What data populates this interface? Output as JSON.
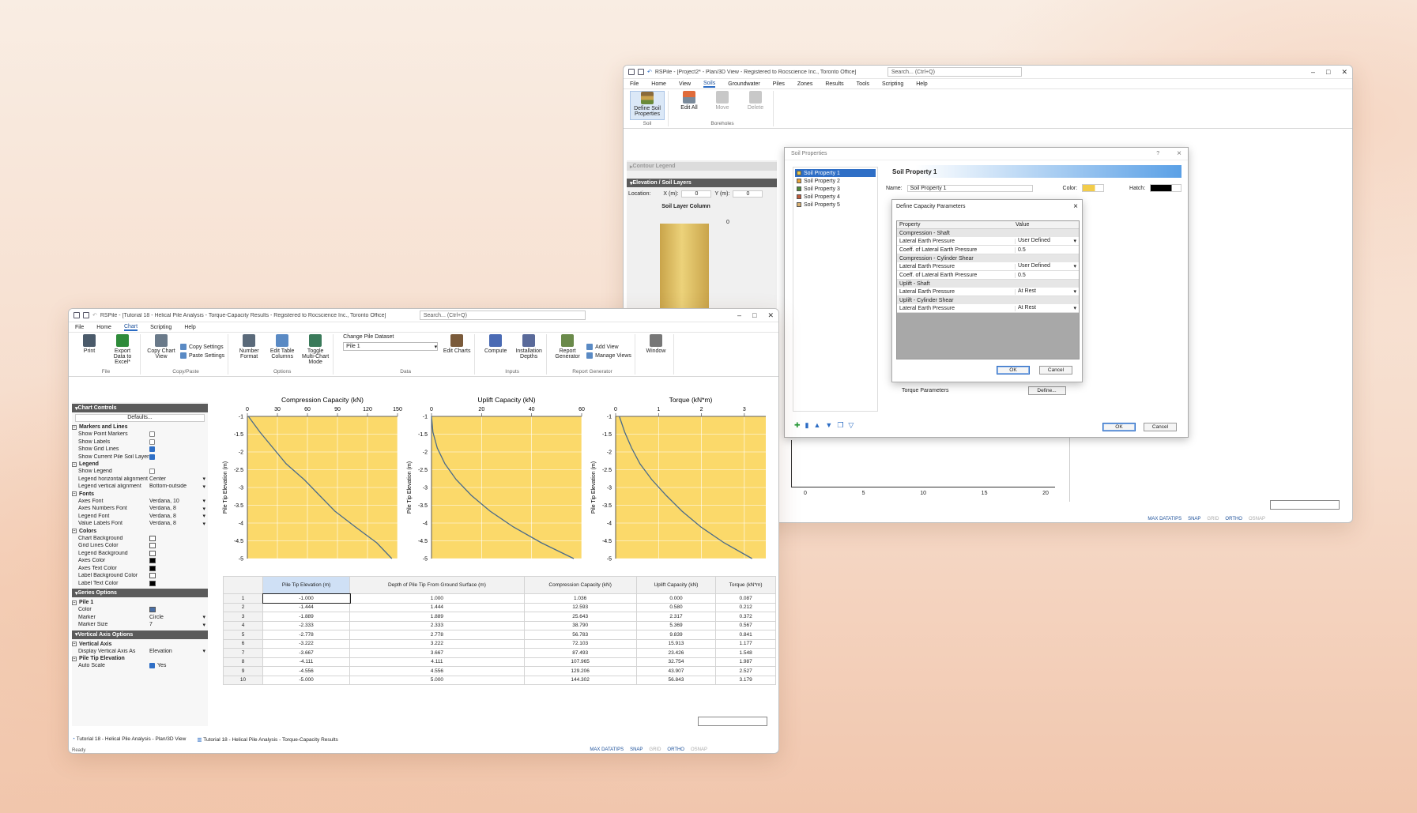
{
  "back": {
    "title": "RSPile - [Project2* - Plan/3D View - Registered to Rocscience Inc., Toronto Office]",
    "search": "Search... (Ctrl+Q)",
    "menu": [
      "File",
      "Home",
      "View",
      "Soils",
      "Groundwater",
      "Piles",
      "Zones",
      "Results",
      "Tools",
      "Scripting",
      "Help"
    ],
    "active_menu": "Soils",
    "ribbon": [
      {
        "label": "Define Soil Properties",
        "group": "Soil"
      },
      {
        "label": "Edit All",
        "group": "Boreholes"
      },
      {
        "label": "Move",
        "group": "Boreholes"
      },
      {
        "label": "Delete",
        "group": "Boreholes"
      }
    ],
    "groups": [
      "Soil",
      "Boreholes"
    ],
    "contour_legend": "Contour Legend",
    "elev_panel": "Elevation / Soil Layers",
    "location_label": "Location:",
    "x_label": "X (m):",
    "x_val": "0",
    "y_label": "Y (m):",
    "y_val": "0",
    "column_title": "Soil Layer Column",
    "column_top": "0",
    "axis_ticks": [
      "0",
      "5",
      "10",
      "15",
      "20"
    ],
    "status": [
      "MAX DATATIPS",
      "SNAP",
      "GRID",
      "ORTHO",
      "OSNAP"
    ]
  },
  "soil_dialog": {
    "title": "Soil Properties",
    "help": "?",
    "close": "×",
    "list": [
      "Soil Property 1",
      "Soil Property 2",
      "Soil Property 3",
      "Soil Property 4",
      "Soil Property 5"
    ],
    "list_colors": [
      "#e9c84a",
      "#e8a33a",
      "#4e8a3a",
      "#c05a3a",
      "#d8b070"
    ],
    "header": "Soil Property 1",
    "name_label": "Name:",
    "name_val": "Soil Property 1",
    "color_label": "Color:",
    "hatch_label": "Hatch:",
    "torque_label": "Torque Parameters",
    "define_btn": "Define...",
    "ok": "OK",
    "cancel": "Cancel"
  },
  "capacity_dialog": {
    "title": "Define Capacity Parameters",
    "close": "×",
    "col_property": "Property",
    "col_value": "Value",
    "rows": [
      {
        "type": "section",
        "label": "Compression - Shaft"
      },
      {
        "type": "row",
        "k": "Lateral Earth Pressure",
        "v": "User Defined",
        "dd": true
      },
      {
        "type": "row",
        "k": "Coeff. of Lateral Earth Pressure",
        "v": "0.5",
        "dd": false
      },
      {
        "type": "section",
        "label": "Compression - Cylinder Shear"
      },
      {
        "type": "row",
        "k": "Lateral Earth Pressure",
        "v": "User Defined",
        "dd": true
      },
      {
        "type": "row",
        "k": "Coeff. of Lateral Earth Pressure",
        "v": "0.5",
        "dd": false
      },
      {
        "type": "section",
        "label": "Uplift - Shaft"
      },
      {
        "type": "row",
        "k": "Lateral Earth Pressure",
        "v": "At Rest",
        "dd": true
      },
      {
        "type": "section",
        "label": "Uplift - Cylinder Shear"
      },
      {
        "type": "row",
        "k": "Lateral Earth Pressure",
        "v": "At Rest",
        "dd": true
      }
    ],
    "ok": "OK",
    "cancel": "Cancel"
  },
  "front": {
    "title": "RSPile - [Tutorial 18 - Helical Pile Analysis - Torque-Capacity Results - Registered to Rocscience Inc., Toronto Office]",
    "search": "Search... (Ctrl+Q)",
    "menu": [
      "File",
      "Home",
      "Chart",
      "Scripting",
      "Help"
    ],
    "active_menu": "Chart",
    "ribbon_groups": [
      {
        "name": "File",
        "buttons": [
          "Print",
          "Export Data to Excel*"
        ],
        "small": []
      },
      {
        "name": "Copy/Paste",
        "buttons": [
          "Copy Chart View"
        ],
        "small": [
          "Copy Settings",
          "Paste Settings"
        ]
      },
      {
        "name": "Options",
        "buttons": [
          "Number Format",
          "Edit Table Columns",
          "Toggle Multi-Chart Mode"
        ],
        "small": []
      },
      {
        "name": "Data",
        "buttons": [
          "Edit Charts"
        ],
        "small": []
      },
      {
        "name": "Inputs",
        "buttons": [
          "Compute",
          "Installation Depths"
        ],
        "small": []
      },
      {
        "name": "Report Generator",
        "buttons": [
          "Report Generator"
        ],
        "small": [
          "Add View",
          "Manage Views"
        ]
      },
      {
        "name": "",
        "buttons": [
          "Window"
        ],
        "small": []
      }
    ],
    "change_pile_label": "Change Pile Dataset",
    "change_pile_val": "Pile 1",
    "chart_controls": "Chart Controls",
    "defaults_btn": "Defaults...",
    "props": [
      {
        "t": "s",
        "label": "Markers and Lines"
      },
      {
        "t": "c",
        "k": "Show Point Markers",
        "on": false
      },
      {
        "t": "c",
        "k": "Show Labels",
        "on": false
      },
      {
        "t": "c",
        "k": "Show Grid Lines",
        "on": true
      },
      {
        "t": "c",
        "k": "Show Current Pile Soil Layers",
        "on": true
      },
      {
        "t": "s",
        "label": "Legend"
      },
      {
        "t": "c",
        "k": "Show Legend",
        "on": false
      },
      {
        "t": "v",
        "k": "Legend horizontal alignment",
        "v": "Center"
      },
      {
        "t": "v",
        "k": "Legend vertical alignment",
        "v": "Bottom-outside"
      },
      {
        "t": "s",
        "label": "Fonts"
      },
      {
        "t": "v",
        "k": "Axes Font",
        "v": "Verdana, 10"
      },
      {
        "t": "v",
        "k": "Axes Numbers Font",
        "v": "Verdana, 8"
      },
      {
        "t": "v",
        "k": "Legend Font",
        "v": "Verdana, 8"
      },
      {
        "t": "v",
        "k": "Value Labels Font",
        "v": "Verdana, 8"
      },
      {
        "t": "s",
        "label": "Colors"
      },
      {
        "t": "k",
        "k": "Chart Background",
        "col": "#ffffff"
      },
      {
        "t": "k",
        "k": "Grid Lines Color",
        "col": "#ffffff"
      },
      {
        "t": "k",
        "k": "Legend Background",
        "col": "#ffffff"
      },
      {
        "t": "k",
        "k": "Axes Color",
        "col": "#000000"
      },
      {
        "t": "k",
        "k": "Axes Text Color",
        "col": "#000000"
      },
      {
        "t": "k",
        "k": "Label Background Color",
        "col": "#ffffff"
      },
      {
        "t": "k",
        "k": "Label Text Color",
        "col": "#000000"
      }
    ],
    "series_hdr": "Series Options",
    "series_props": [
      {
        "t": "s",
        "label": "Pile 1"
      },
      {
        "t": "k",
        "k": "Color",
        "col": "#4a6fa5"
      },
      {
        "t": "v",
        "k": "Marker",
        "v": "Circle"
      },
      {
        "t": "v",
        "k": "Marker Size",
        "v": "7"
      }
    ],
    "vaxis_hdr": "Vertical Axis Options",
    "vaxis_props": [
      {
        "t": "s",
        "label": "Vertical Axis"
      },
      {
        "t": "v",
        "k": "Display Vertical Axis As",
        "v": "Elevation"
      },
      {
        "t": "s",
        "label": "Pile Tip Elevation"
      },
      {
        "t": "c",
        "k": "Auto Scale",
        "on": true,
        "extra": "Yes"
      }
    ],
    "table_headers": [
      "Pile Tip Elevation (m)",
      "Depth of Pile Tip From Ground Surface (m)",
      "Compression Capacity (kN)",
      "Uplift Capacity (kN)",
      "Torque (kN*m)"
    ],
    "table": [
      [
        "1",
        "-1.000",
        "1.000",
        "1.036",
        "0.000",
        "0.087"
      ],
      [
        "2",
        "-1.444",
        "1.444",
        "12.593",
        "0.580",
        "0.212"
      ],
      [
        "3",
        "-1.889",
        "1.889",
        "25.643",
        "2.317",
        "0.372"
      ],
      [
        "4",
        "-2.333",
        "2.333",
        "38.790",
        "5.369",
        "0.567"
      ],
      [
        "5",
        "-2.778",
        "2.778",
        "56.783",
        "9.839",
        "0.841"
      ],
      [
        "6",
        "-3.222",
        "3.222",
        "72.103",
        "15.913",
        "1.177"
      ],
      [
        "7",
        "-3.667",
        "3.667",
        "87.493",
        "23.426",
        "1.548"
      ],
      [
        "8",
        "-4.111",
        "4.111",
        "107.965",
        "32.754",
        "1.987"
      ],
      [
        "9",
        "-4.556",
        "4.556",
        "129.206",
        "43.907",
        "2.527"
      ],
      [
        "10",
        "-5.000",
        "5.000",
        "144.302",
        "56.843",
        "3.179"
      ]
    ],
    "tabs": [
      "Tutorial 18 - Helical Pile Analysis - Plan/3D View",
      "Tutorial 18 - Helical Pile Analysis - Torque-Capacity Results"
    ],
    "ready": "Ready",
    "status": [
      "MAX DATATIPS",
      "SNAP",
      "GRID",
      "ORTHO",
      "OSNAP"
    ]
  },
  "chart_data": [
    {
      "type": "line",
      "title": "Compression Capacity (kN)",
      "ylabel": "Pile Tip Elevation (m)",
      "xlim": [
        0,
        150
      ],
      "ylim": [
        -5,
        -1
      ],
      "xticks": [
        "0",
        "30",
        "60",
        "90",
        "120",
        "150"
      ],
      "yticks": [
        "-1",
        "-1.5",
        "-2",
        "-2.5",
        "-3",
        "-3.5",
        "-4",
        "-4.5",
        "-5"
      ],
      "grid": true,
      "background": "#fbd96a",
      "line_color": "#4a6b8a",
      "x": [
        1.036,
        12.593,
        25.643,
        38.79,
        56.783,
        72.103,
        87.493,
        107.965,
        129.206,
        144.302
      ],
      "y": [
        -1,
        -1.444,
        -1.889,
        -2.333,
        -2.778,
        -3.222,
        -3.667,
        -4.111,
        -4.556,
        -5
      ]
    },
    {
      "type": "line",
      "title": "Uplift Capacity (kN)",
      "ylabel": "Pile Tip Elevation (m)",
      "xlim": [
        0,
        60
      ],
      "ylim": [
        -5,
        -1
      ],
      "xticks": [
        "0",
        "20",
        "40",
        "60"
      ],
      "yticks": [
        "-1",
        "-1.5",
        "-2",
        "-2.5",
        "-3",
        "-3.5",
        "-4",
        "-4.5",
        "-5"
      ],
      "grid": true,
      "background": "#fbd96a",
      "line_color": "#4a6b8a",
      "x": [
        0,
        0.58,
        2.317,
        5.369,
        9.839,
        15.913,
        23.426,
        32.754,
        43.907,
        56.843
      ],
      "y": [
        -1,
        -1.444,
        -1.889,
        -2.333,
        -2.778,
        -3.222,
        -3.667,
        -4.111,
        -4.556,
        -5
      ]
    },
    {
      "type": "line",
      "title": "Torque (kN*m)",
      "ylabel": "Pile Tip Elevation (m)",
      "xlim": [
        0,
        3.5
      ],
      "ylim": [
        -5,
        -1
      ],
      "xticks": [
        "0",
        "1",
        "2",
        "3"
      ],
      "yticks": [
        "-1",
        "-1.5",
        "-2",
        "-2.5",
        "-3",
        "-3.5",
        "-4",
        "-4.5",
        "-5"
      ],
      "grid": true,
      "background": "#fbd96a",
      "line_color": "#4a6b8a",
      "x": [
        0.087,
        0.212,
        0.372,
        0.567,
        0.841,
        1.177,
        1.548,
        1.987,
        2.527,
        3.179
      ],
      "y": [
        -1,
        -1.444,
        -1.889,
        -2.333,
        -2.778,
        -3.222,
        -3.667,
        -4.111,
        -4.556,
        -5
      ]
    }
  ]
}
